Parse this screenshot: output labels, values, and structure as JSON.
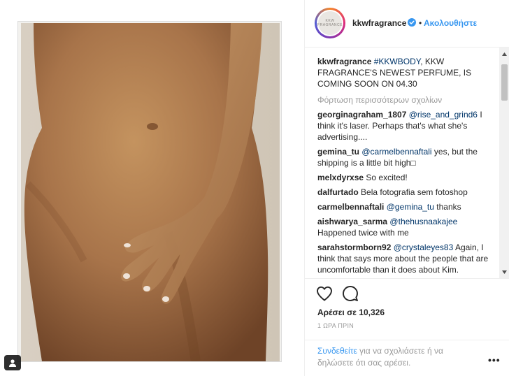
{
  "post": {
    "username": "kkwfragrance",
    "follow_label": "Ακολουθήστε",
    "separator": "•",
    "avatar_text_line1": "KKW",
    "avatar_text_line2": "FRAGRANCE",
    "caption_username": "kkwfragrance",
    "caption_hashtag": "#KKWBODY",
    "caption_text": ", KKW FRAGRANCE'S NEWEST PERFUME, IS COMING SOON ON 04.30",
    "load_more": "Φόρτωση περισσότερων σχολίων",
    "likes_label": "Αρέσει σε 10,326",
    "time_ago": "1 ΩΡΑ ΠΡΙΝ",
    "login_link": "Συνδεθείτε",
    "login_text": " για να σχολιάσετε ή να δηλώσετε ότι σας αρέσει.",
    "more_label": "•••"
  },
  "comments": [
    {
      "user": "georginagraham_1807",
      "mention": "@rise_and_grind6",
      "text": " I think it's laser. Perhaps that's what she's advertising...."
    },
    {
      "user": "gemina_tu",
      "mention": "@carmelbennaftali",
      "text": " yes, but the shipping is a little bit high□"
    },
    {
      "user": "melxdyrxse",
      "mention": "",
      "text": "So excited!"
    },
    {
      "user": "dalfurtado",
      "mention": "",
      "text": "Bela fotografia sem fotoshop"
    },
    {
      "user": "carmelbennaftali",
      "mention": "@gemina_tu",
      "text": " thanks"
    },
    {
      "user": "aishwarya_sarma",
      "mention": "@thehusnaakajee",
      "text": " Happened twice with me"
    },
    {
      "user": "sarahstormborn92",
      "mention": "@crystaleyes83",
      "text": " Again, I think that says more about the people that are uncomfortable than it does about Kim."
    }
  ],
  "colors": {
    "link_blue": "#3897f0",
    "mention_blue": "#003569",
    "muted_gray": "#999999",
    "text_dark": "#262626"
  },
  "icons": [
    "verified-badge-icon",
    "heart-icon",
    "comment-icon",
    "user-tag-icon",
    "scroll-up-arrow-icon",
    "scroll-down-arrow-icon"
  ]
}
